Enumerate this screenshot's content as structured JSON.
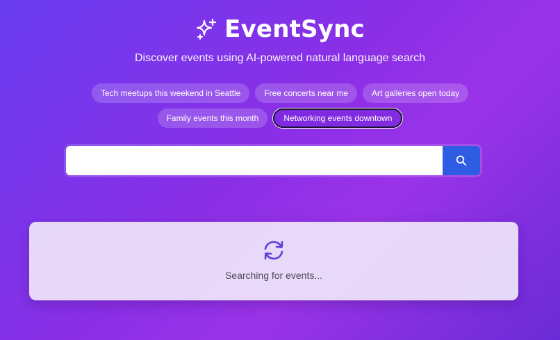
{
  "header": {
    "title": "EventSync",
    "logo_icon": "sparkles-icon",
    "subtitle": "Discover events using AI-powered natural language search"
  },
  "suggestions": {
    "row1": [
      {
        "label": "Tech meetups this weekend in Seattle"
      },
      {
        "label": "Free concerts near me"
      },
      {
        "label": "Art galleries open today"
      }
    ],
    "row2": [
      {
        "label": "Family events this month"
      },
      {
        "label": "Networking events downtown",
        "active": true
      }
    ]
  },
  "search": {
    "value": "",
    "placeholder": "",
    "button_icon": "search-icon"
  },
  "loading": {
    "icon": "refresh-icon",
    "text": "Searching for events..."
  },
  "colors": {
    "search_button": "#2e5de3",
    "spinner": "#5b3fd6",
    "card_background": "#ece2fa"
  }
}
